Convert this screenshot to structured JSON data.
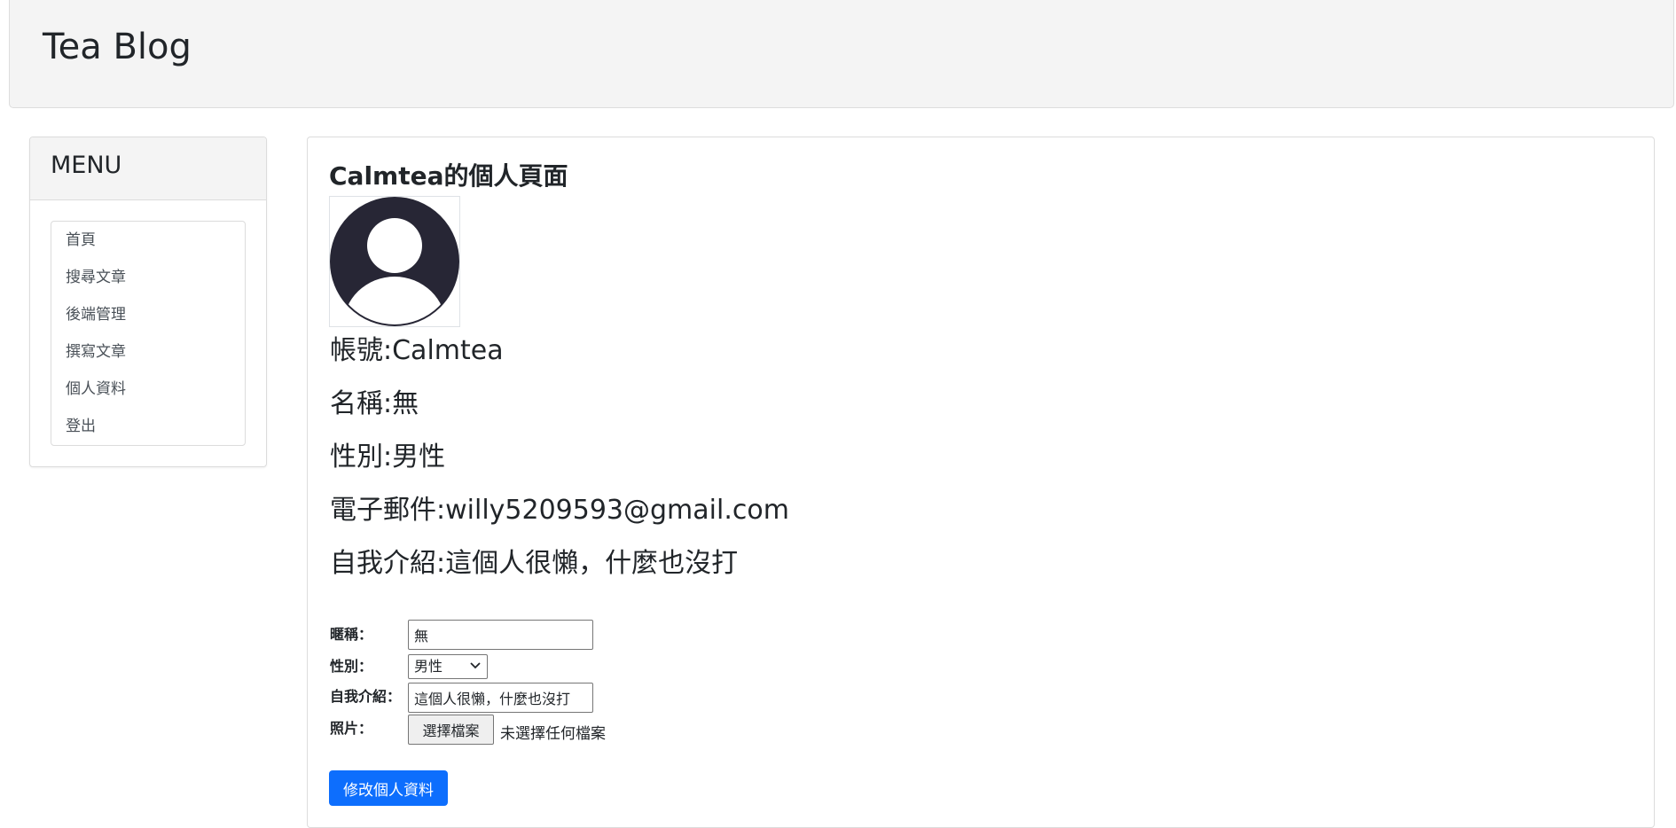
{
  "header": {
    "brand": "Tea Blog"
  },
  "sidebar": {
    "title": "MENU",
    "items": [
      {
        "label": "首頁"
      },
      {
        "label": "搜尋文章"
      },
      {
        "label": "後端管理"
      },
      {
        "label": "撰寫文章"
      },
      {
        "label": "個人資料"
      },
      {
        "label": "登出"
      }
    ]
  },
  "profile": {
    "title": "Calmtea的個人頁面",
    "avatar_icon": "user-silhouette-icon",
    "avatar_color": "#272635",
    "account": "帳號:Calmtea",
    "name": "名稱:無",
    "gender": "性別:男性",
    "email": "電子郵件:willy5209593@gmail.com",
    "bio": "自我介紹:這個人很懶，什麼也沒打"
  },
  "form": {
    "nickname_label": "暱稱：",
    "nickname_value": "無",
    "gender_label": "性別：",
    "gender_selected": "男性",
    "bio_label": "自我介紹：",
    "bio_value": "這個人很懶，什麼也沒打",
    "photo_label": "照片：",
    "file_button_label": "選擇檔案",
    "file_status": "未選擇任何檔案",
    "submit_label": "修改個人資料",
    "accent_color": "#0d6efd"
  }
}
